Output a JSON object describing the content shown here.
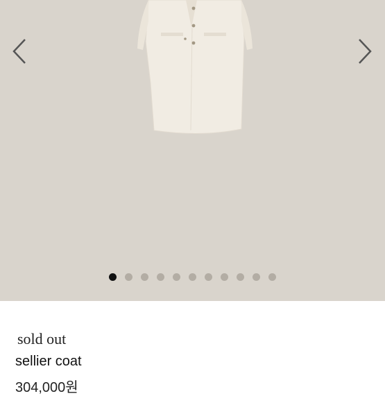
{
  "gallery": {
    "image_subject": "cream long coat",
    "prev_icon": "chevron-left-icon",
    "next_icon": "chevron-right-icon",
    "slide_count": 11,
    "active_slide": 1,
    "colors": {
      "background": "#d9d4cc",
      "dot_active": "#111111",
      "dot_inactive": "#b3ada4"
    }
  },
  "product": {
    "status": "sold out",
    "name": "sellier coat",
    "price": "304,000원"
  }
}
